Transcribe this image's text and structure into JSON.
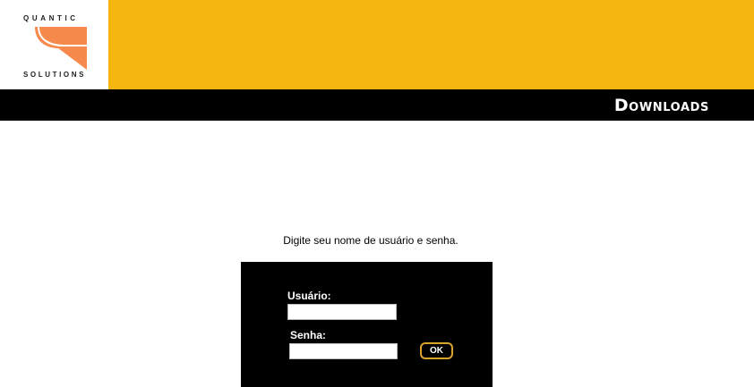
{
  "header": {
    "logo": {
      "top_word": "QUANTIC",
      "bottom_word": "SOLUTIONS"
    },
    "title": "Downloads",
    "accent_color": "#f5b60f",
    "logo_color": "#f58a4c"
  },
  "login": {
    "instruction": "Digite seu nome de usuário e senha.",
    "username_label": "Usuário:",
    "username_value": "",
    "password_label": "Senha:",
    "password_value": "",
    "ok_label": "OK"
  }
}
